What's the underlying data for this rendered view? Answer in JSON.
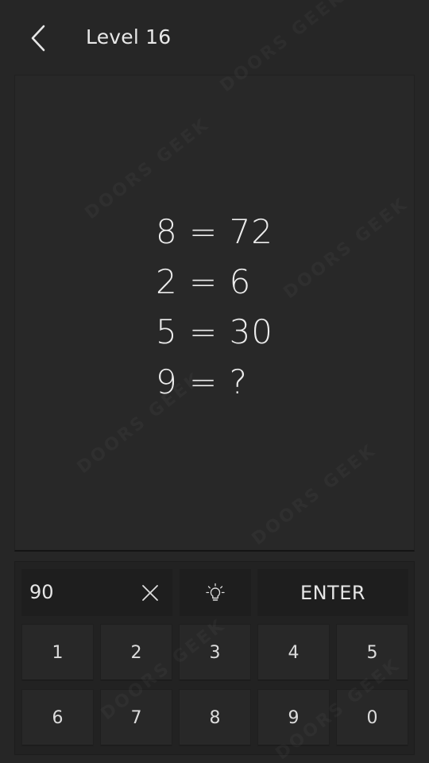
{
  "header": {
    "back_icon": "chevron-left-icon",
    "title": "Level 16"
  },
  "puzzle": {
    "lines": [
      "8 = 72",
      "2 = 6",
      "5 = 30",
      "9 = ?"
    ]
  },
  "input": {
    "answer_value": "90",
    "clear_icon": "close-icon",
    "hint_icon": "lightbulb-icon",
    "enter_label": "ENTER"
  },
  "keypad": {
    "keys": [
      "1",
      "2",
      "3",
      "4",
      "5",
      "6",
      "7",
      "8",
      "9",
      "0"
    ]
  },
  "watermark": "DOORS GEEK",
  "colors": {
    "background": "#262626",
    "panel": "#282828",
    "button": "#1e1e1e",
    "text": "#e6e6e6"
  }
}
